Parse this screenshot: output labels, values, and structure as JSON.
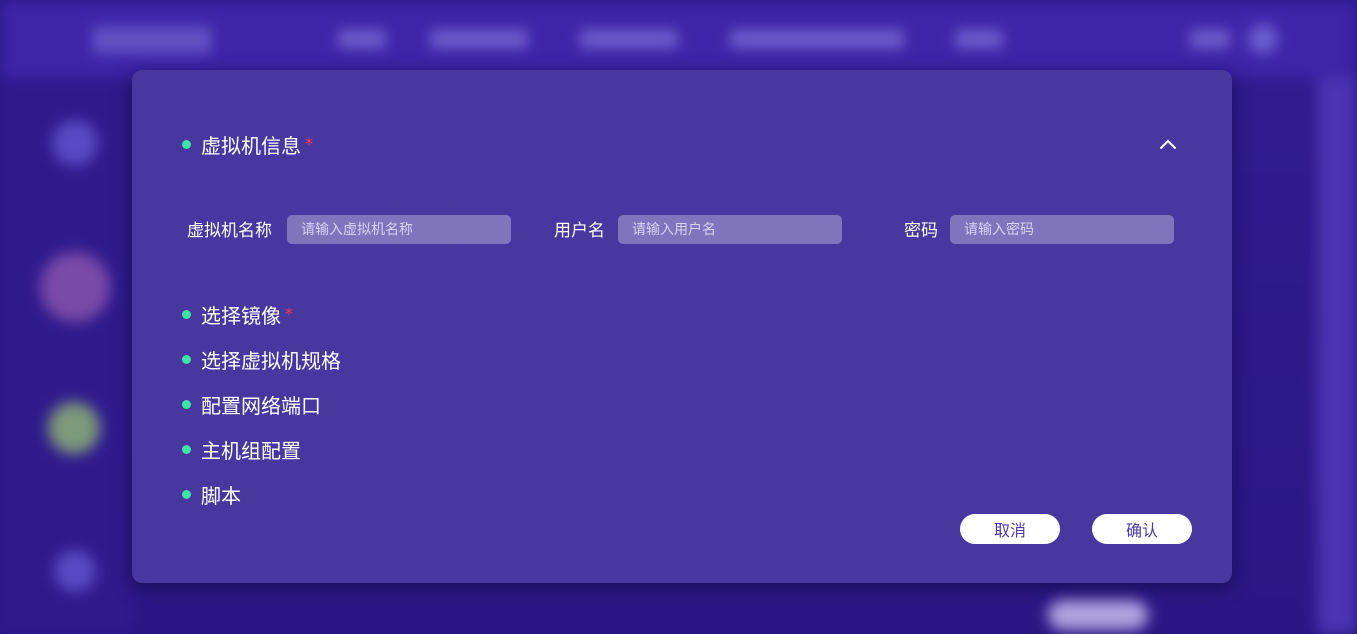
{
  "modal": {
    "sections": [
      {
        "label": "虚拟机信息",
        "required": true,
        "expanded": true
      },
      {
        "label": "选择镜像",
        "required": true
      },
      {
        "label": "选择虚拟机规格",
        "required": false
      },
      {
        "label": "配置网络端口",
        "required": false
      },
      {
        "label": "主机组配置",
        "required": false
      },
      {
        "label": "脚本",
        "required": false
      }
    ],
    "required_mark": "*",
    "fields": {
      "vm_name": {
        "label": "虚拟机名称",
        "placeholder": "请输入虚拟机名称",
        "value": ""
      },
      "username": {
        "label": "用户名",
        "placeholder": "请输入用户名",
        "value": ""
      },
      "password": {
        "label": "密码",
        "placeholder": "请输入密码",
        "value": ""
      }
    },
    "buttons": {
      "cancel": "取消",
      "confirm": "确认"
    }
  },
  "colors": {
    "accent_dot": "#3fe3a5",
    "required": "#ff3b4e",
    "modal_bg": "#4a38a0",
    "input_bg": "#8074bd"
  },
  "icons": {
    "collapse": "chevron-up-icon"
  }
}
